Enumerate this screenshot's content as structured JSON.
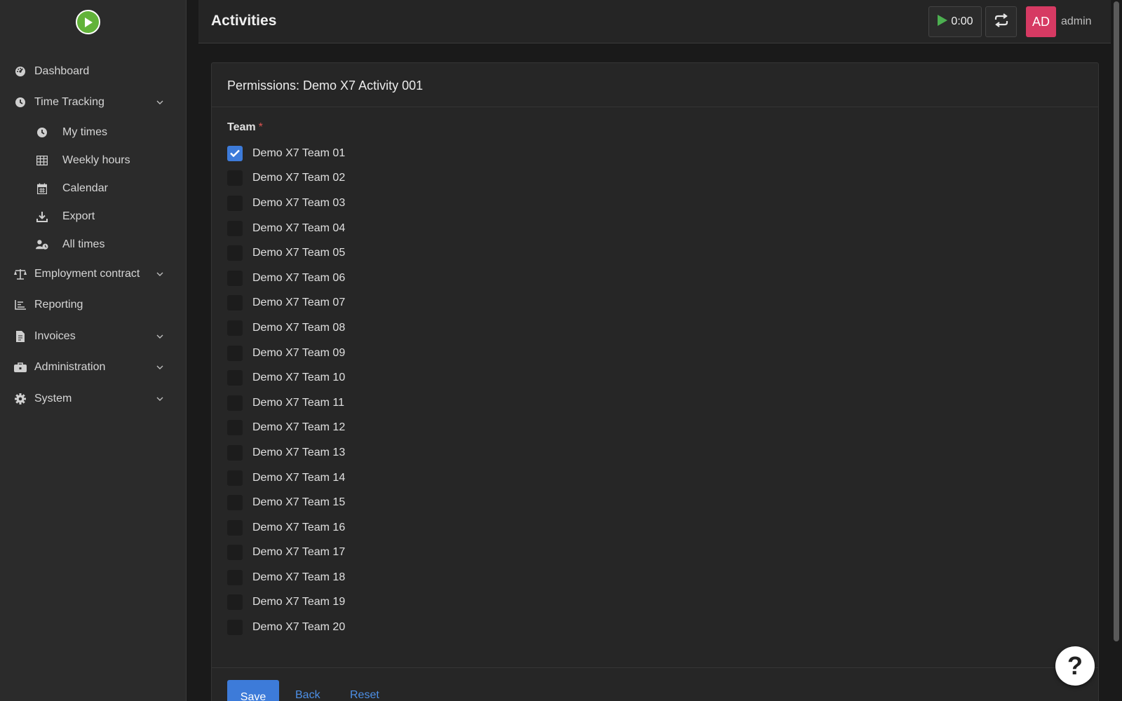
{
  "header": {
    "title": "Activities",
    "timer": "0:00",
    "avatar_initials": "AD",
    "username": "admin"
  },
  "sidebar": {
    "items": [
      {
        "label": "Dashboard",
        "icon": "dashboard-icon"
      },
      {
        "label": "Time Tracking",
        "icon": "clock-icon",
        "expanded": true
      },
      {
        "label": "Employment contract",
        "icon": "scale-icon"
      },
      {
        "label": "Reporting",
        "icon": "chart-icon"
      },
      {
        "label": "Invoices",
        "icon": "invoice-icon"
      },
      {
        "label": "Administration",
        "icon": "toolbox-icon"
      },
      {
        "label": "System",
        "icon": "gear-icon"
      }
    ],
    "subitems": [
      {
        "label": "My times",
        "icon": "clock-icon"
      },
      {
        "label": "Weekly hours",
        "icon": "table-icon"
      },
      {
        "label": "Calendar",
        "icon": "calendar-icon"
      },
      {
        "label": "Export",
        "icon": "download-icon"
      },
      {
        "label": "All times",
        "icon": "user-clock-icon"
      }
    ]
  },
  "card": {
    "title": "Permissions: Demo X7 Activity 001",
    "field_label": "Team",
    "required_mark": "*",
    "teams": [
      {
        "label": "Demo X7 Team 01",
        "checked": true
      },
      {
        "label": "Demo X7 Team 02",
        "checked": false
      },
      {
        "label": "Demo X7 Team 03",
        "checked": false
      },
      {
        "label": "Demo X7 Team 04",
        "checked": false
      },
      {
        "label": "Demo X7 Team 05",
        "checked": false
      },
      {
        "label": "Demo X7 Team 06",
        "checked": false
      },
      {
        "label": "Demo X7 Team 07",
        "checked": false
      },
      {
        "label": "Demo X7 Team 08",
        "checked": false
      },
      {
        "label": "Demo X7 Team 09",
        "checked": false
      },
      {
        "label": "Demo X7 Team 10",
        "checked": false
      },
      {
        "label": "Demo X7 Team 11",
        "checked": false
      },
      {
        "label": "Demo X7 Team 12",
        "checked": false
      },
      {
        "label": "Demo X7 Team 13",
        "checked": false
      },
      {
        "label": "Demo X7 Team 14",
        "checked": false
      },
      {
        "label": "Demo X7 Team 15",
        "checked": false
      },
      {
        "label": "Demo X7 Team 16",
        "checked": false
      },
      {
        "label": "Demo X7 Team 17",
        "checked": false
      },
      {
        "label": "Demo X7 Team 18",
        "checked": false
      },
      {
        "label": "Demo X7 Team 19",
        "checked": false
      },
      {
        "label": "Demo X7 Team 20",
        "checked": false
      }
    ],
    "save_label": "Save",
    "back_label": "Back",
    "reset_label": "Reset"
  },
  "help": {
    "label": "?"
  },
  "colors": {
    "accent": "#3d7bd9",
    "avatar_bg": "#d63a63",
    "logo_green": "#62b33a",
    "required_red": "#d9534f"
  }
}
